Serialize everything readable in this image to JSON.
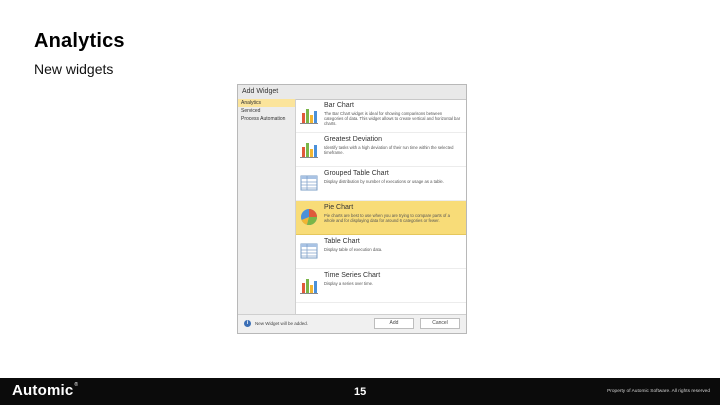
{
  "slide": {
    "title": "Analytics",
    "subtitle": "New widgets"
  },
  "dialog": {
    "title": "Add Widget",
    "sidebar": [
      {
        "label": "Analytics",
        "active": true
      },
      {
        "label": "Serviced",
        "active": false
      },
      {
        "label": "Process Automation",
        "active": false
      }
    ],
    "widgets": [
      {
        "title": "Bar Chart",
        "description": "The Bar Chart widget is ideal for showing comparisons between categories of data. This widget allows to create vertical and horizontal bar charts.",
        "icon": "bar-chart-icon"
      },
      {
        "title": "Greatest Deviation",
        "description": "Identify tasks with a high deviation of their run time within the selected timeframe.",
        "icon": "bar-chart-icon"
      },
      {
        "title": "Grouped Table Chart",
        "description": "Display distribution by number of executions or usage as a table.",
        "icon": "table-icon"
      },
      {
        "title": "Pie Chart",
        "description": "Pie charts are best to use when you are trying to compare parts of a whole and for displaying data for around 6 categories or fewer.",
        "icon": "pie-chart-icon",
        "selected": true
      },
      {
        "title": "Table Chart",
        "description": "Display table of execution data.",
        "icon": "table-icon"
      },
      {
        "title": "Time Series Chart",
        "description": "Display a series over time.",
        "icon": "bar-chart-icon"
      }
    ],
    "footer": {
      "note": "New Widget will be added.",
      "add_label": "Add",
      "cancel_label": "Cancel"
    }
  },
  "bottom_bar": {
    "brand": "Automic",
    "trademark": "®",
    "page_number": "15",
    "copyright": "Property of Automic Software. All rights reserved"
  },
  "colors": {
    "selected_item": "#f8dc78",
    "sidebar_active": "#fbe49b",
    "bottom_bar": "#0b0b0b"
  }
}
